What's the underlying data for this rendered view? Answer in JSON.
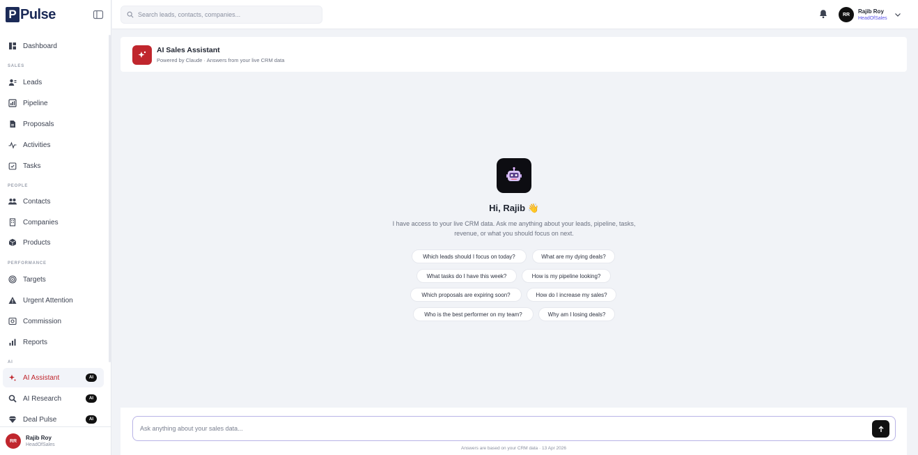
{
  "brand": {
    "mark": "P",
    "name": "Pulse"
  },
  "search": {
    "placeholder": "Search leads, contacts, companies..."
  },
  "sections": {
    "sales": "SALES",
    "people": "PEOPLE",
    "performance": "PERFORMANCE",
    "ai": "AI"
  },
  "nav": {
    "dashboard": "Dashboard",
    "leads": "Leads",
    "pipeline": "Pipeline",
    "proposals": "Proposals",
    "activities": "Activities",
    "tasks": "Tasks",
    "contacts": "Contacts",
    "companies": "Companies",
    "products": "Products",
    "targets": "Targets",
    "urgent": "Urgent Attention",
    "commission": "Commission",
    "reports": "Reports",
    "ai_assistant": "AI Assistant",
    "ai_research": "AI Research",
    "deal_pulse": "Deal Pulse",
    "badge": "AI"
  },
  "user": {
    "initials": "RR",
    "name": "Rajib Roy",
    "role": "HeadOfSales"
  },
  "header": {
    "title": "AI Sales Assistant",
    "subtitle": "Powered by Claude · Answers from your live CRM data"
  },
  "welcome": {
    "greeting": "Hi, Rajib 👋",
    "intro": "I have access to your live CRM data. Ask me anything about your leads, pipeline, tasks, revenue, or what you should focus on next."
  },
  "suggestions": [
    "Which leads should I focus on today?",
    "What are my dying deals?",
    "What tasks do I have this week?",
    "How is my pipeline looking?",
    "Which proposals are expiring soon?",
    "How do I increase my sales?",
    "Who is the best performer on my team?",
    "Why am I losing deals?"
  ],
  "composer": {
    "placeholder": "Ask anything about your sales data...",
    "footnote": "Answers are based on your CRM data · 13 Apr 2026"
  },
  "colors": {
    "accent": "#c0262d",
    "brand": "#1b2a57",
    "role_text": "#5b54e8"
  }
}
